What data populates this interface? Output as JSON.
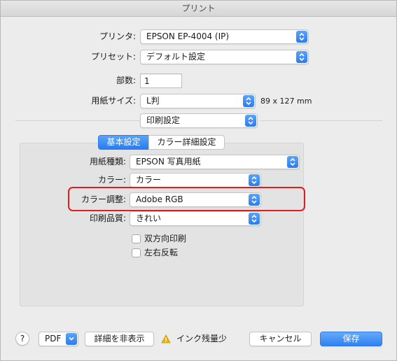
{
  "window": {
    "title": "プリント"
  },
  "printer": {
    "label": "プリンタ:",
    "value": "EPSON EP-4004 (IP)"
  },
  "preset": {
    "label": "プリセット:",
    "value": "デフォルト設定"
  },
  "copies": {
    "label": "部数:",
    "value": "1"
  },
  "paper_size": {
    "label": "用紙サイズ:",
    "value": "L判",
    "dimensions": "89 x 127 mm"
  },
  "panel": {
    "value": "印刷設定"
  },
  "tabs": {
    "basic": "基本設定",
    "color_detail": "カラー詳細設定"
  },
  "settings": {
    "media_type": {
      "label": "用紙種類:",
      "value": "EPSON 写真用紙"
    },
    "color": {
      "label": "カラー:",
      "value": "カラー"
    },
    "color_adjust": {
      "label": "カラー調整:",
      "value": "Adobe RGB"
    },
    "quality": {
      "label": "印刷品質:",
      "value": "きれい"
    },
    "bidirectional": {
      "label": "双方向印刷",
      "checked": false
    },
    "mirror": {
      "label": "左右反転",
      "checked": false
    }
  },
  "footer": {
    "help": "?",
    "pdf": "PDF",
    "hide_details": "詳細を非表示",
    "ink_warning": "インク残量少",
    "cancel": "キャンセル",
    "print": "保存"
  },
  "colors": {
    "accent": "#2b7cf0",
    "highlight": "#e01e1e",
    "warning": "#e8b400"
  },
  "icons": {
    "stepper": "up-down-chevron-icon",
    "warning": "warning-triangle-icon",
    "pdf_menu": "chevron-down-icon"
  }
}
